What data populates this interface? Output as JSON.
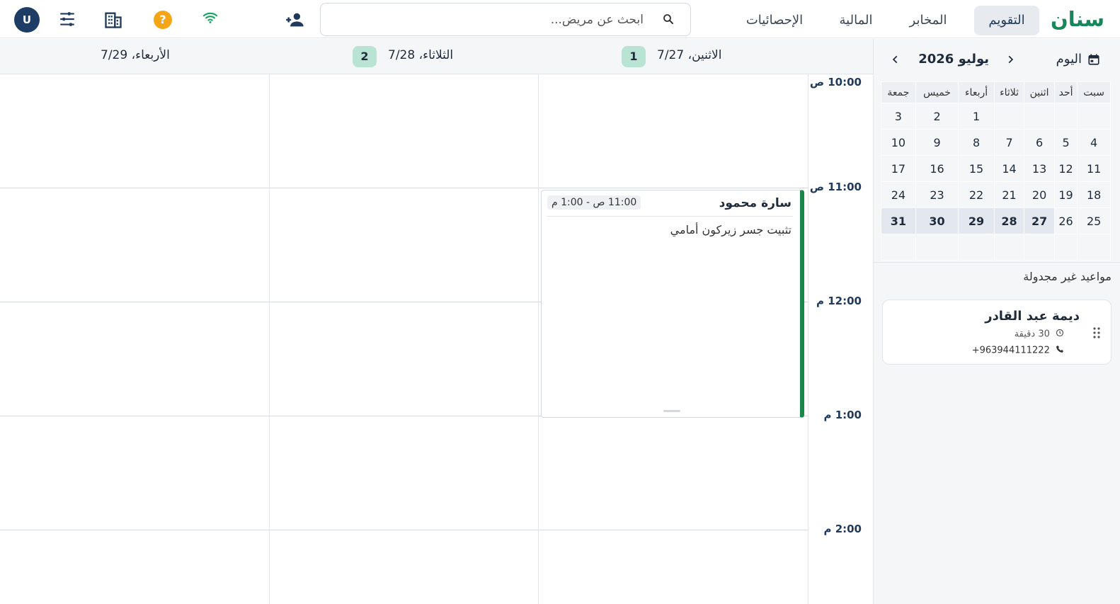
{
  "brand": "سنان",
  "nav": {
    "tabs": [
      {
        "label": "التقويم",
        "active": true
      },
      {
        "label": "المخابر",
        "active": false
      },
      {
        "label": "المالية",
        "active": false
      },
      {
        "label": "الإحصائيات",
        "active": false
      }
    ]
  },
  "search": {
    "placeholder": "ابحث عن مريض..."
  },
  "header_icons": [
    "add-person-icon",
    "wifi-icon",
    "help-icon",
    "building-icon",
    "sliders-icon",
    "avatar"
  ],
  "user": {
    "initial": "U"
  },
  "sidebar": {
    "today_label": "اليوم",
    "month_label": "يوليو 2026",
    "weekdays": [
      "سبت",
      "أحد",
      "اثنين",
      "ثلاثاء",
      "أربعاء",
      "خميس",
      "جمعة"
    ],
    "weeks": [
      [
        "",
        "",
        "",
        "",
        "1",
        "2",
        "3"
      ],
      [
        "4",
        "5",
        "6",
        "7",
        "8",
        "9",
        "10"
      ],
      [
        "11",
        "12",
        "13",
        "14",
        "15",
        "16",
        "17"
      ],
      [
        "18",
        "19",
        "20",
        "21",
        "22",
        "23",
        "24"
      ],
      [
        "25",
        "26",
        "27",
        "28",
        "29",
        "30",
        "31"
      ],
      [
        "",
        "",
        "",
        "",
        "",
        "",
        ""
      ]
    ],
    "unscheduled_title": "مواعيد غير مجدولة",
    "unscheduled": [
      {
        "name": "ديمة عبد القادر",
        "duration": "30 دقيقة",
        "phone": "+963944111222"
      }
    ]
  },
  "days": [
    {
      "label": "الاثنين، 7/27",
      "count": "1"
    },
    {
      "label": "الثلاثاء، 7/28",
      "count": "2"
    },
    {
      "label": "الأربعاء، 7/29",
      "count": ""
    }
  ],
  "times": [
    "10:00 ص",
    "11:00 ص",
    "12:00 م",
    "1:00 م",
    "2:00 م"
  ],
  "appointment": {
    "name": "سارة محمود",
    "time": "11:00 ص - 1:00 م",
    "description": "تثبيت جسر زيركون أمامي",
    "status_color": "#18894a"
  },
  "colors": {
    "brand": "#16875a",
    "accent": "#1d3c66",
    "badge": "#b9e3d2",
    "warning": "#f5a515"
  }
}
